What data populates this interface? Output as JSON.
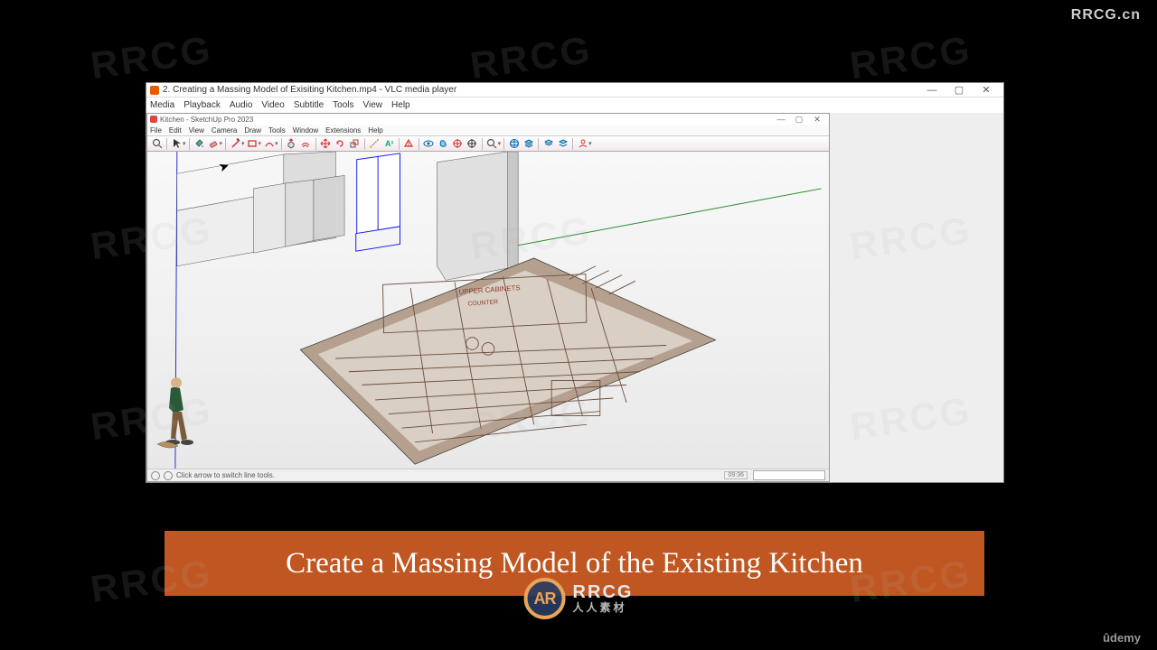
{
  "brand": {
    "top_right": "RRCG.cn",
    "bottom_right": "ûdemy",
    "logo_main": "RRCG",
    "logo_sub": "人人素材"
  },
  "watermark": "RRCG",
  "vlc": {
    "title": "2. Creating a Massing Model of Exisiting Kitchen.mp4 - VLC media player",
    "menu": [
      "Media",
      "Playback",
      "Audio",
      "Video",
      "Subtitle",
      "Tools",
      "View",
      "Help"
    ],
    "win_min": "—",
    "win_max": "▢",
    "win_close": "✕"
  },
  "sketchup": {
    "title": "Kitchen - SketchUp Pro 2023",
    "menu": [
      "File",
      "Edit",
      "View",
      "Camera",
      "Draw",
      "Tools",
      "Window",
      "Extensions",
      "Help"
    ],
    "status_hint": "Click arrow to switch line tools.",
    "time_display": "09:36",
    "toolbar_names": [
      "search-icon",
      "select-arrow-icon",
      "paint-bucket-icon",
      "eraser-icon",
      "line-icon",
      "freehand-icon",
      "rectangle-icon",
      "circle-icon",
      "arc-icon",
      "push-pull-icon",
      "offset-icon",
      "move-icon",
      "rotate-icon",
      "scale-icon",
      "tape-icon",
      "dimension-icon",
      "text-icon",
      "axes-icon",
      "section-icon",
      "orbit-icon",
      "pan-icon",
      "zoom-icon",
      "zoom-extents-icon",
      "warehouse-icon",
      "extension-icon",
      "layers-icon",
      "profile-1-icon",
      "profile-2-icon",
      "user-icon"
    ]
  },
  "banner": {
    "title": "Create a Massing Model of the Existing Kitchen"
  }
}
